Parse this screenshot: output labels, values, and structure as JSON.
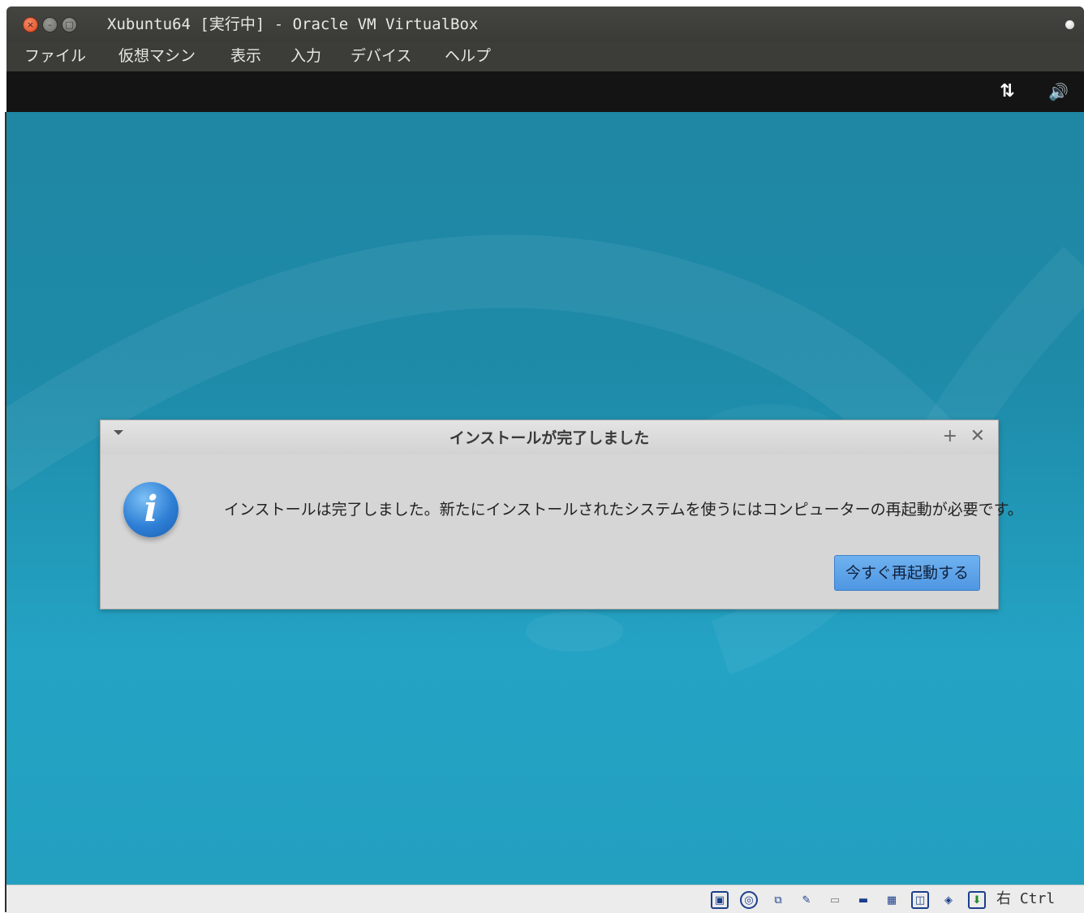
{
  "window": {
    "title": "Xubuntu64 [実行中] - Oracle VM VirtualBox",
    "close_glyph": "×",
    "minimize_glyph": "–",
    "maximize_glyph": "□"
  },
  "menu": {
    "items": [
      "ファイル",
      "仮想マシン",
      "表示",
      "入力",
      "デバイス",
      "ヘルプ"
    ]
  },
  "guest_panel": {
    "network_icon": "network-transfer-icon",
    "network_glyph": "⇅",
    "volume_icon": "volume-icon",
    "volume_glyph": "🔊"
  },
  "dialog": {
    "title": "インストールが完了しました",
    "pin_glyph": "+",
    "close_glyph": "✕",
    "info_glyph": "i",
    "message": "インストールは完了しました。新たにインストールされたシステムを使うにはコンピューターの再起動が必要です。",
    "button_label": "今すぐ再起動する",
    "button_color": "#5a9fe6"
  },
  "statusbar": {
    "icons": [
      {
        "name": "hard-disk-icon",
        "glyph": "▣"
      },
      {
        "name": "optical-drive-icon",
        "glyph": "◎"
      },
      {
        "name": "network-adapter-icon",
        "glyph": "⧉"
      },
      {
        "name": "usb-icon",
        "glyph": "✎"
      },
      {
        "name": "shared-folder-icon",
        "glyph": "▭"
      },
      {
        "name": "display-icon",
        "glyph": "▬"
      },
      {
        "name": "video-capture-icon",
        "glyph": "▦"
      },
      {
        "name": "cpu-icon",
        "glyph": "◫"
      },
      {
        "name": "mouse-integration-icon",
        "glyph": "◈"
      },
      {
        "name": "keyboard-capture-icon",
        "glyph": "⬇"
      }
    ],
    "host_key": "右 Ctrl"
  },
  "colors": {
    "titlebar": "#3e3e3b",
    "desktop": "#1e8ba9",
    "dialog_bg": "#d6d6d6",
    "close_button": "#e8562a"
  }
}
